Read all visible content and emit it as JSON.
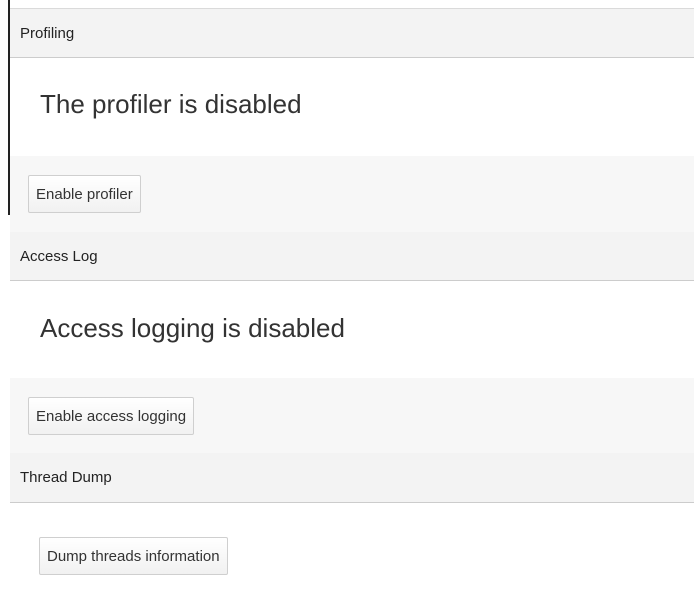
{
  "profiling": {
    "header": "Profiling",
    "status": "The profiler is disabled",
    "button_label": "Enable profiler"
  },
  "access_log": {
    "header": "Access Log",
    "status": "Access logging is disabled",
    "button_label": "Enable access logging"
  },
  "thread_dump": {
    "header": "Thread Dump",
    "button_label": "Dump threads information"
  }
}
